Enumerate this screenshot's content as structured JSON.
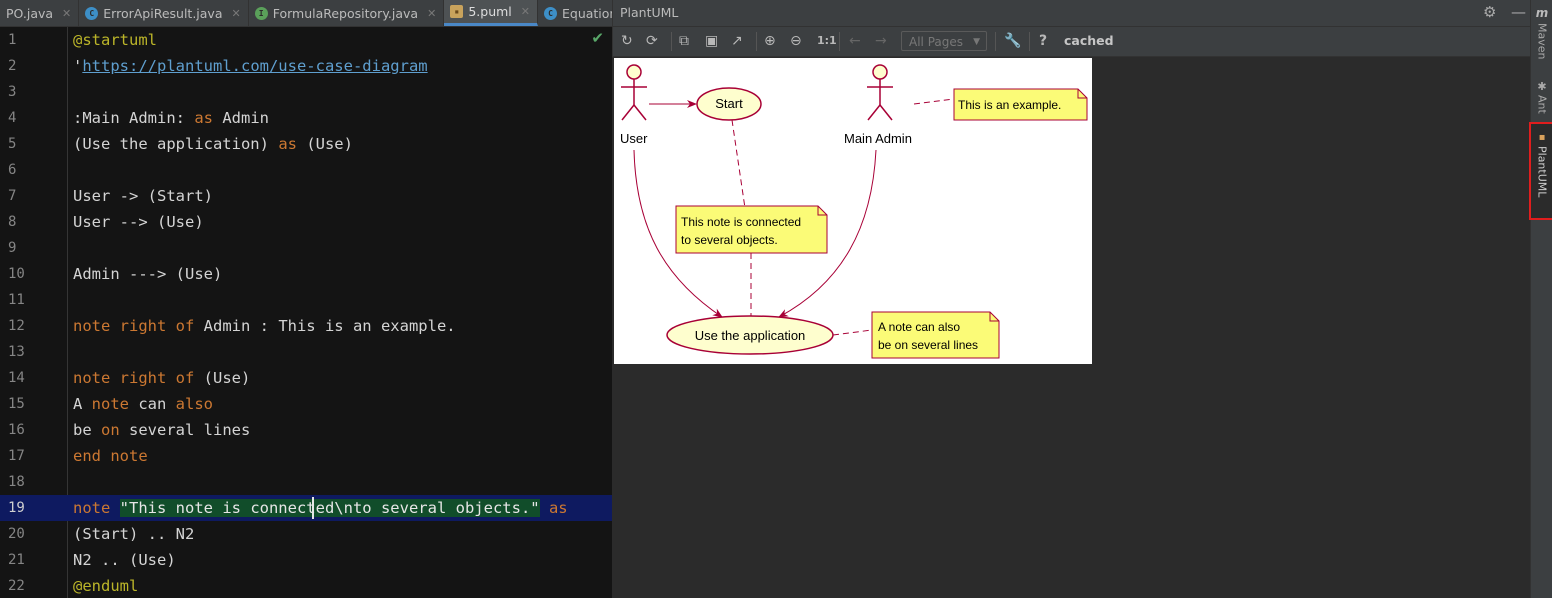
{
  "tabs": [
    {
      "label": "PO.java",
      "icon": "none"
    },
    {
      "label": "ErrorApiResult.java",
      "icon": "class-icon"
    },
    {
      "label": "FormulaRepository.java",
      "icon": "interface-icon"
    },
    {
      "label": "5.puml",
      "icon": "puml-icon",
      "active": true
    },
    {
      "label": "EquationP",
      "icon": "class-icon"
    }
  ],
  "tab_overflow": "⌄",
  "editor": {
    "current_line": 19,
    "lines": [
      {
        "n": "1",
        "seg": [
          [
            "ann",
            "@startuml"
          ]
        ]
      },
      {
        "n": "2",
        "seg": [
          [
            "",
            "'"
          ],
          [
            "link",
            "https://plantuml.com/use-case-diagram"
          ]
        ]
      },
      {
        "n": "3",
        "seg": []
      },
      {
        "n": "4",
        "seg": [
          [
            "",
            ":Main Admin: "
          ],
          [
            "kw",
            "as"
          ],
          [
            "",
            " Admin"
          ]
        ]
      },
      {
        "n": "5",
        "seg": [
          [
            "",
            "(Use the application) "
          ],
          [
            "kw",
            "as"
          ],
          [
            "",
            " (Use)"
          ]
        ]
      },
      {
        "n": "6",
        "seg": []
      },
      {
        "n": "7",
        "seg": [
          [
            "",
            "User -> (Start)"
          ]
        ]
      },
      {
        "n": "8",
        "seg": [
          [
            "",
            "User --> (Use)"
          ]
        ]
      },
      {
        "n": "9",
        "seg": []
      },
      {
        "n": "10",
        "seg": [
          [
            "",
            "Admin ---> (Use)"
          ]
        ]
      },
      {
        "n": "11",
        "seg": []
      },
      {
        "n": "12",
        "seg": [
          [
            "kw",
            "note right of"
          ],
          [
            "",
            " Admin : This is an example."
          ]
        ]
      },
      {
        "n": "13",
        "seg": []
      },
      {
        "n": "14",
        "seg": [
          [
            "kw",
            "note right of"
          ],
          [
            "",
            " (Use)"
          ]
        ]
      },
      {
        "n": "15",
        "seg": [
          [
            "",
            "A "
          ],
          [
            "kw",
            "note"
          ],
          [
            "",
            " can "
          ],
          [
            "kw",
            "also"
          ]
        ]
      },
      {
        "n": "16",
        "seg": [
          [
            "",
            "be "
          ],
          [
            "kw",
            "on"
          ],
          [
            "",
            " several lines"
          ]
        ]
      },
      {
        "n": "17",
        "seg": [
          [
            "kw",
            "end note"
          ]
        ]
      },
      {
        "n": "18",
        "seg": []
      },
      {
        "n": "19",
        "seg": [
          [
            "kw",
            "note"
          ],
          [
            "",
            " "
          ],
          [
            "str",
            "\"This note is connected\\nto several objects.\""
          ],
          [
            "",
            " "
          ],
          [
            "kw",
            "as"
          ]
        ]
      },
      {
        "n": "20",
        "seg": [
          [
            "",
            "(Start) .. N2"
          ]
        ]
      },
      {
        "n": "21",
        "seg": [
          [
            "",
            "N2 .. (Use)"
          ]
        ]
      },
      {
        "n": "22",
        "seg": [
          [
            "ann",
            "@enduml"
          ]
        ]
      }
    ]
  },
  "plantuml": {
    "title": "PlantUML",
    "pages_label": "All Pages",
    "zoom_reset_label": "1:1",
    "help_label": "?",
    "status": "cached",
    "toolbar_icons": [
      "refresh-icon",
      "sync-icon",
      "copy-icon",
      "save-icon",
      "export-icon",
      "zoom-in-icon",
      "zoom-out-icon",
      "back-arrow-icon",
      "forward-arrow-icon",
      "settings-wrench-icon",
      "help-icon"
    ]
  },
  "diagram": {
    "actors": [
      "User",
      "Main Admin"
    ],
    "usecases": [
      "Start",
      "Use the application"
    ],
    "notes": {
      "admin_note": "This is an example.",
      "n2_line1": "This note is connected",
      "n2_line2": "to several objects.",
      "use_line1": "A note can also",
      "use_line2": "be on several lines"
    }
  },
  "right_stripe": {
    "items": [
      {
        "icon": "m",
        "label": "Maven"
      },
      {
        "icon": "ant-icon",
        "label": "Ant"
      },
      {
        "icon": "puml-icon",
        "label": "PlantUML",
        "highlighted": true
      }
    ]
  },
  "colors": {
    "accent_tab": "#4a88c7",
    "diagram_stroke": "#a80036",
    "actor_fill": "#fefece",
    "note_fill": "#fbfb77",
    "highlight_box": "#e01d1d"
  }
}
